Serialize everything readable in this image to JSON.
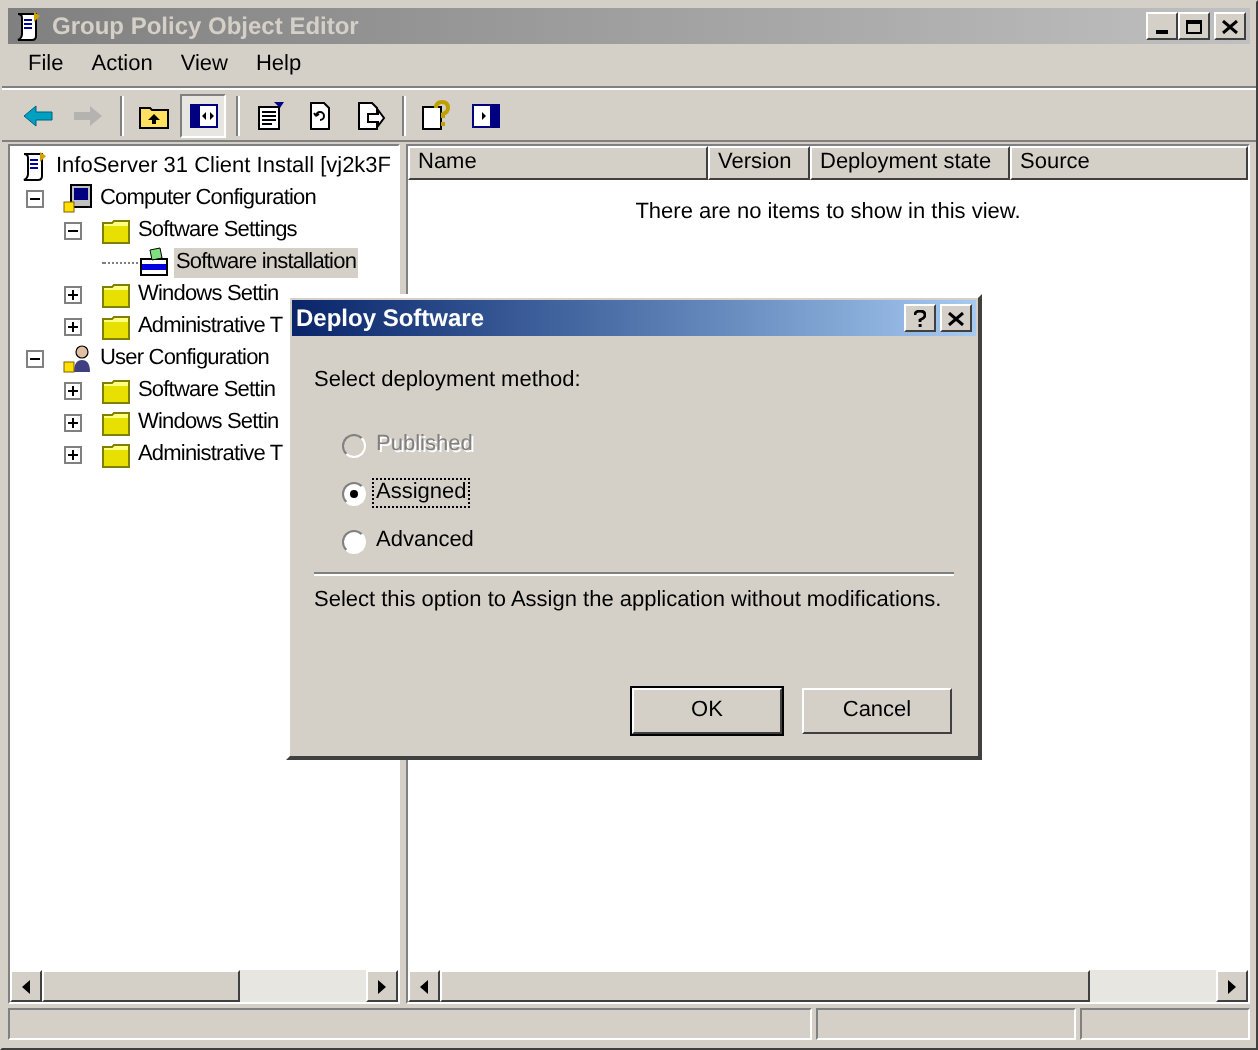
{
  "window": {
    "title": "Group Policy Object Editor",
    "active": false
  },
  "menu": [
    {
      "label": "File"
    },
    {
      "label": "Action"
    },
    {
      "label": "View"
    },
    {
      "label": "Help"
    }
  ],
  "toolbar": [
    {
      "disabled": false,
      "pressed": false
    },
    {
      "disabled": true,
      "pressed": false
    },
    {
      "disabled": false,
      "pressed": false
    },
    {
      "disabled": false,
      "pressed": true
    },
    {
      "disabled": false,
      "pressed": false
    },
    {
      "disabled": false,
      "pressed": false
    },
    {
      "disabled": false,
      "pressed": false
    },
    {
      "disabled": false,
      "pressed": false
    },
    {
      "disabled": false,
      "pressed": false
    }
  ],
  "tree": {
    "root": {
      "label": "InfoServer 31 Client Install [vj2k3F",
      "children": [
        {
          "label": "Computer Configuration",
          "kind": "computer",
          "expanded": true,
          "selected": false,
          "children": [
            {
              "label": "Software Settings",
              "kind": "folder",
              "expanded": true,
              "selected": false,
              "children": [
                {
                  "label": "Software installation",
                  "kind": "package",
                  "selected": true
                }
              ]
            },
            {
              "label": "Windows Settin",
              "kind": "folder",
              "expanded": false,
              "selected": false
            },
            {
              "label": "Administrative T",
              "kind": "folder",
              "expanded": false,
              "selected": false
            }
          ]
        },
        {
          "label": "User Configuration",
          "kind": "user",
          "expanded": true,
          "selected": false,
          "children": [
            {
              "label": "Software Settin",
              "kind": "folder",
              "expanded": false,
              "selected": false
            },
            {
              "label": "Windows Settin",
              "kind": "folder",
              "expanded": false,
              "selected": false
            },
            {
              "label": "Administrative T",
              "kind": "folder",
              "expanded": false,
              "selected": false
            }
          ]
        }
      ]
    }
  },
  "list": {
    "columns": [
      "Name",
      "Version",
      "Deployment state",
      "Source"
    ],
    "empty_message": "There are no items to show in this view."
  },
  "dialog": {
    "title": "Deploy Software",
    "prompt": "Select deployment method:",
    "options": [
      {
        "label": "Published",
        "selected": false,
        "disabled": true,
        "focused": false
      },
      {
        "label": "Assigned",
        "selected": true,
        "disabled": false,
        "focused": true
      },
      {
        "label": "Advanced",
        "selected": false,
        "disabled": false,
        "focused": false
      }
    ],
    "description": "Select this option to Assign the application without modifications.",
    "buttons": [
      {
        "label": "OK",
        "default": true
      },
      {
        "label": "Cancel",
        "default": false
      }
    ]
  }
}
